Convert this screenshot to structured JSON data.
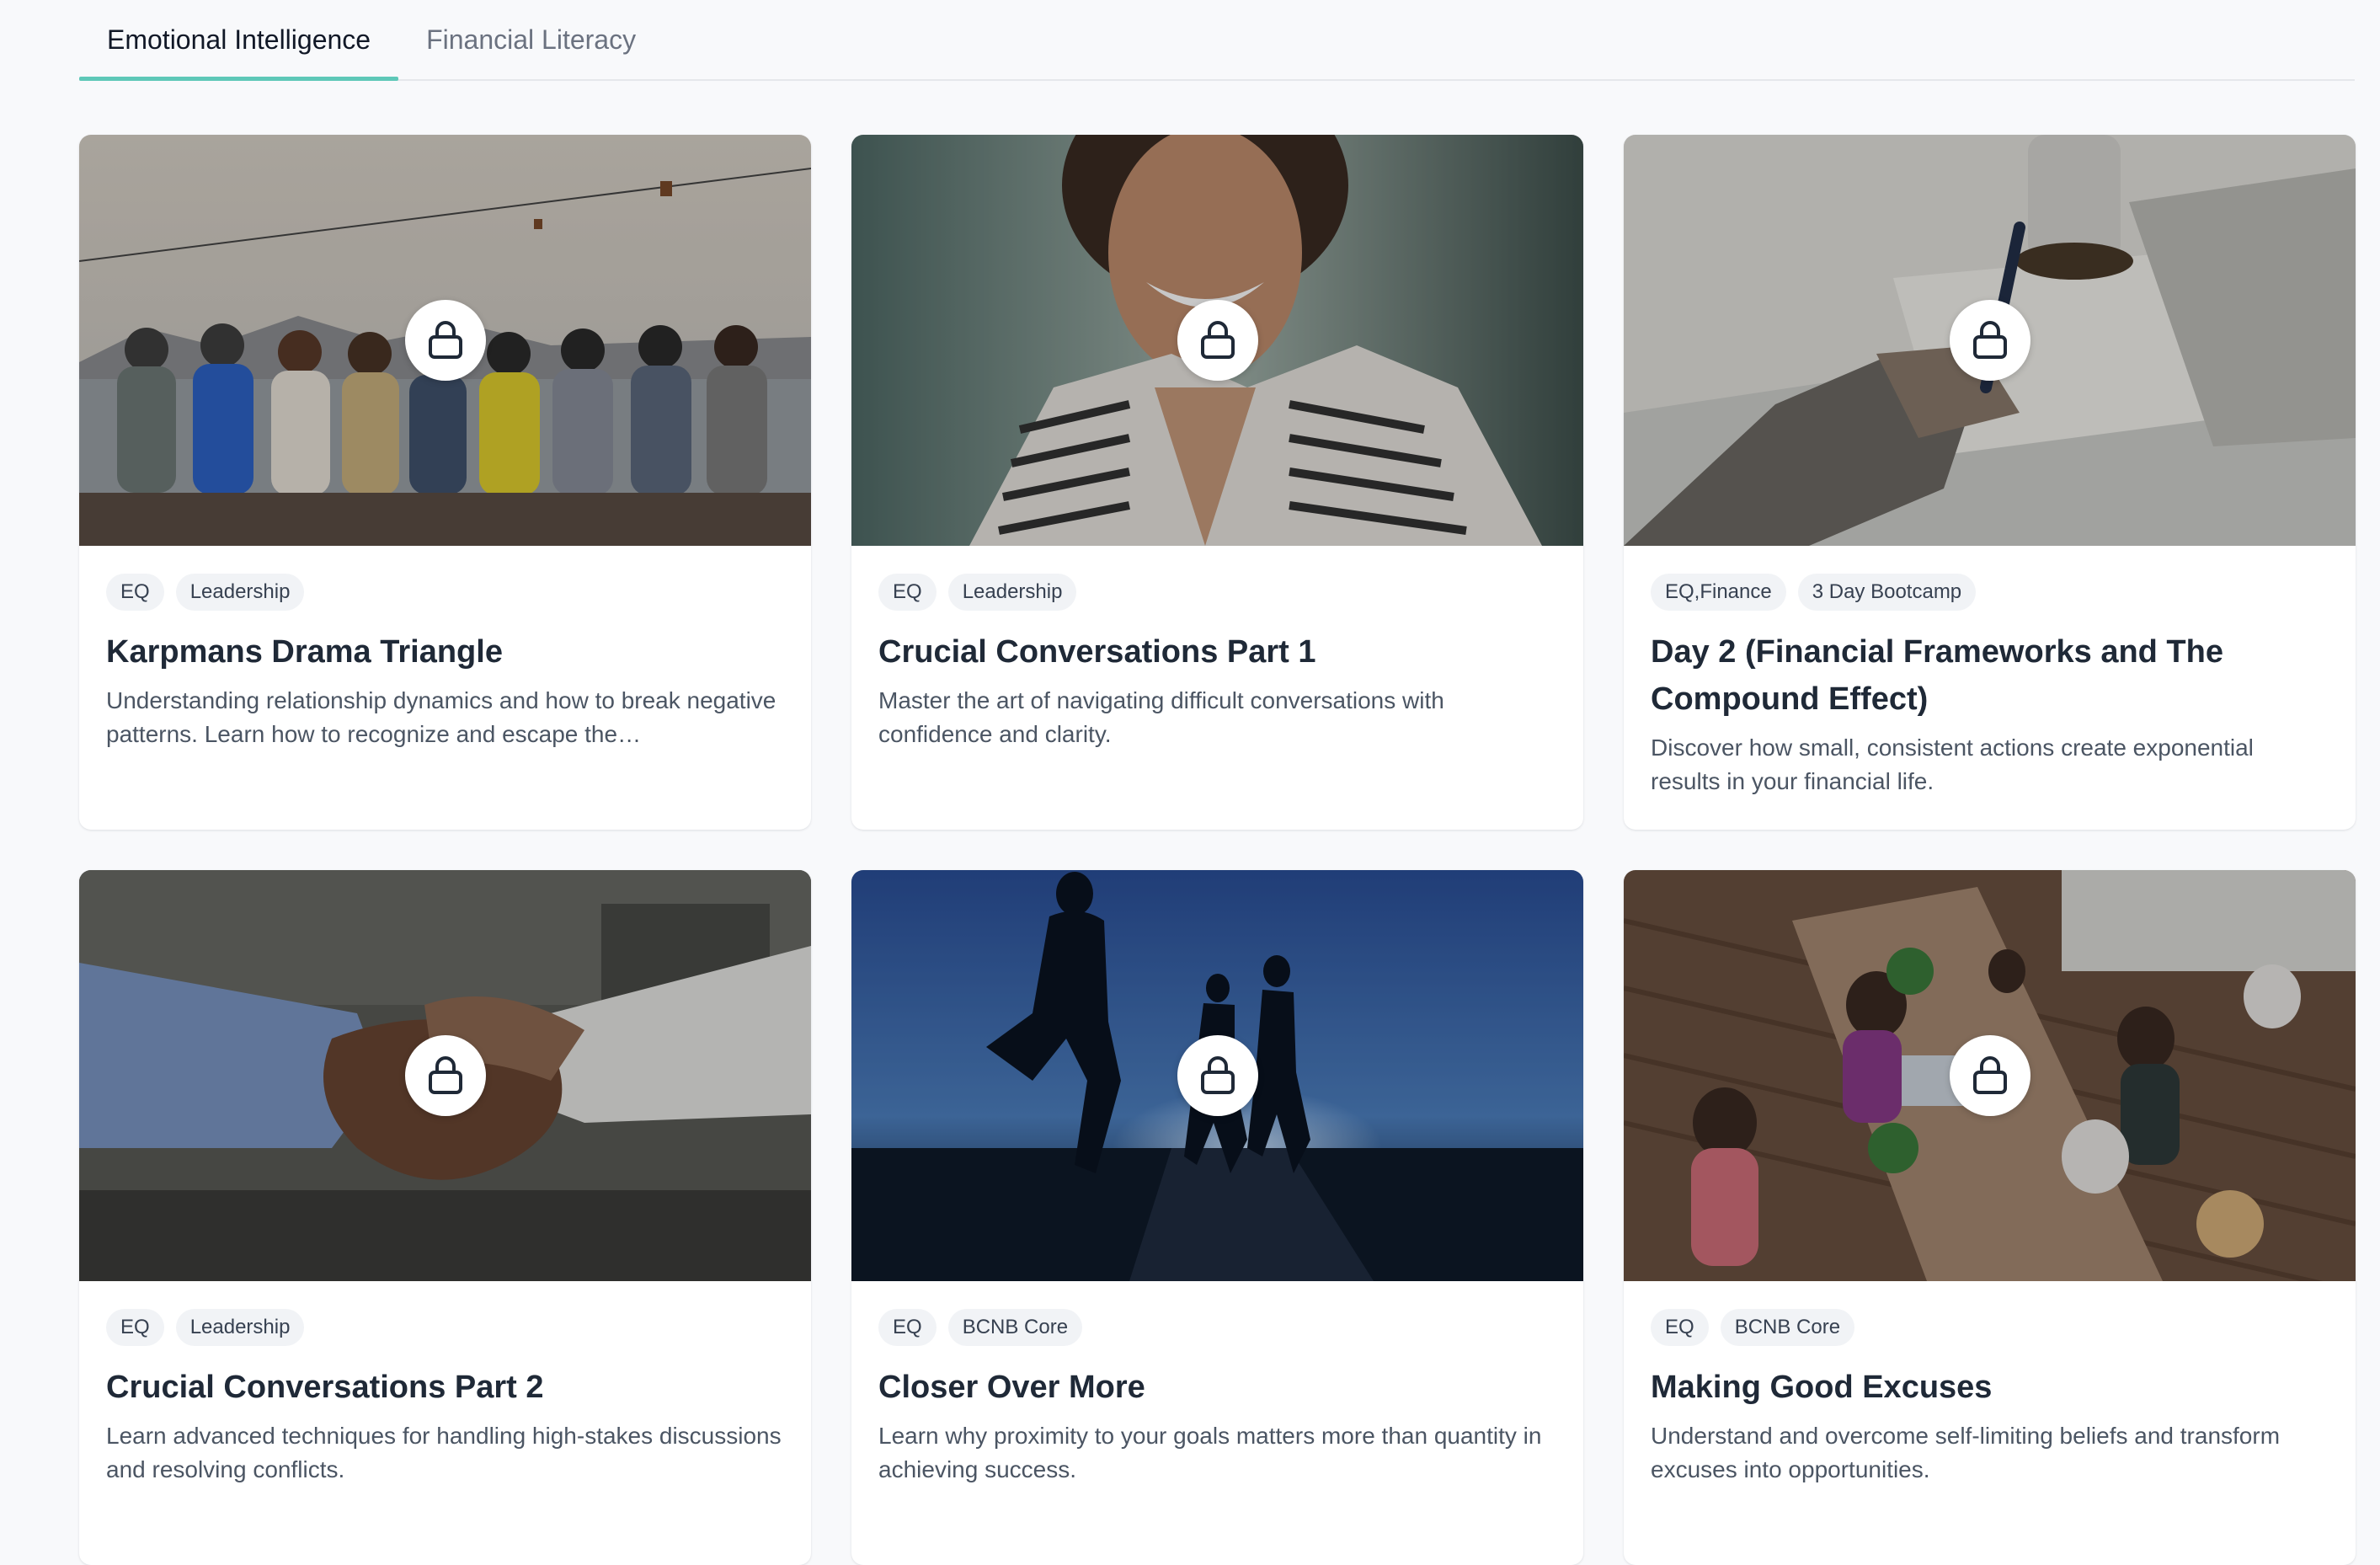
{
  "tabs": [
    {
      "label": "Emotional Intelligence",
      "active": true
    },
    {
      "label": "Financial Literacy",
      "active": false
    }
  ],
  "cards": [
    {
      "tags": [
        "EQ",
        "Leadership"
      ],
      "title": "Karpmans Drama Triangle",
      "description": "Understanding relationship dynamics and how to break negative patterns. Learn how to recognize and escape the…",
      "image": "group-of-friends-arms-around-each-other-by-sea",
      "locked": true
    },
    {
      "tags": [
        "EQ",
        "Leadership"
      ],
      "title": "Crucial Conversations Part 1",
      "description": "Master the art of navigating difficult conversations with confidence and clarity.",
      "image": "smiling-woman-portrait",
      "locked": true
    },
    {
      "tags": [
        "EQ,Finance",
        "3 Day Bootcamp"
      ],
      "title": "Day 2 (Financial Frameworks and The Compound Effect)",
      "description": "Discover how small, consistent actions create exponential results in your financial life.",
      "image": "hand-writing-with-pen-on-desk",
      "locked": true
    },
    {
      "tags": [
        "EQ",
        "Leadership"
      ],
      "title": "Crucial Conversations Part 2",
      "description": "Learn advanced techniques for handling high-stakes discussions and resolving conflicts.",
      "image": "handshake",
      "locked": true
    },
    {
      "tags": [
        "EQ",
        "BCNB Core"
      ],
      "title": "Closer Over More",
      "description": "Learn why proximity to your goals matters more than quantity in achieving success.",
      "image": "runners-silhouette-at-dawn",
      "locked": true
    },
    {
      "tags": [
        "EQ",
        "BCNB Core"
      ],
      "title": "Making Good Excuses",
      "description": "Understand and overcome self-limiting beliefs and transform excuses into opportunities.",
      "image": "team-working-at-long-table",
      "locked": true
    }
  ],
  "icons": {
    "lock": "lock-icon"
  },
  "colors": {
    "accent": "#5ec8b8",
    "background": "#f8f9fb",
    "card": "#ffffff"
  }
}
